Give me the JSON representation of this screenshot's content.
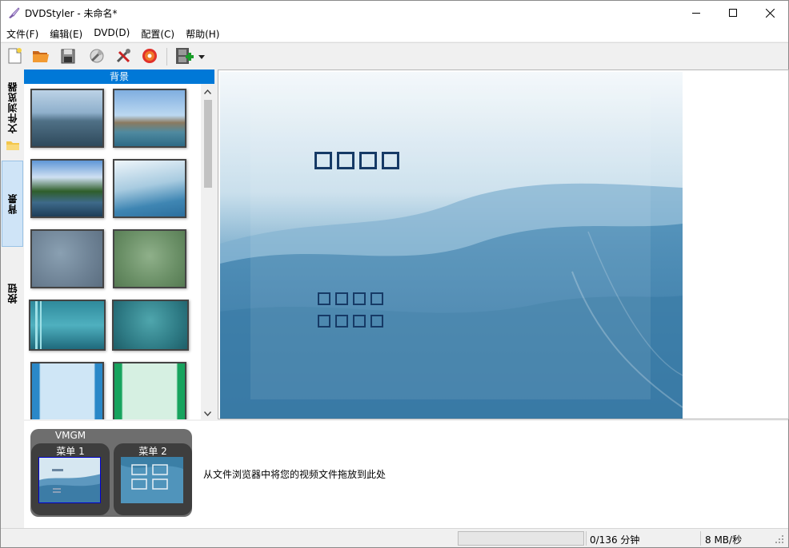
{
  "window": {
    "title": "DVDStyler - 未命名*",
    "controls": [
      "minimize-icon",
      "maximize-icon",
      "close-icon"
    ]
  },
  "menubar": {
    "items": [
      "文件(F)",
      "编辑(E)",
      "DVD(D)",
      "配置(C)",
      "帮助(H)"
    ]
  },
  "toolbar": {
    "buttons": [
      "new-project-icon",
      "open-folder-icon",
      "save-icon",
      "settings-wrench-icon",
      "tools-icon",
      "burn-disc-icon",
      "add-video-icon",
      "dropdown-arrow-icon"
    ]
  },
  "side_tabs": {
    "items": [
      {
        "label": "文件浏览器",
        "icon": "folder-icon"
      },
      {
        "label": "背景",
        "active": true
      },
      {
        "label": "按钮"
      }
    ]
  },
  "panel": {
    "header": "背景",
    "thumbnails": [
      "sea-island",
      "shipwreck-beach",
      "river-forest",
      "blue-waves",
      "grey-blue-texture",
      "green-texture",
      "teal-stripes",
      "teal-grunge",
      "light-blue-borders",
      "green-borders"
    ]
  },
  "bottom": {
    "vmgm_label": "VMGM",
    "menus": [
      "菜单 1",
      "菜单 2"
    ],
    "drop_hint": "从文件浏览器中将您的视频文件拖放到此处"
  },
  "statusbar": {
    "duration": "0/136 分钟",
    "rate": "8 MB/秒"
  },
  "colors": {
    "accent": "#0078d7",
    "canvas_blue": "#3f84ad",
    "button_square": "#163a66"
  }
}
